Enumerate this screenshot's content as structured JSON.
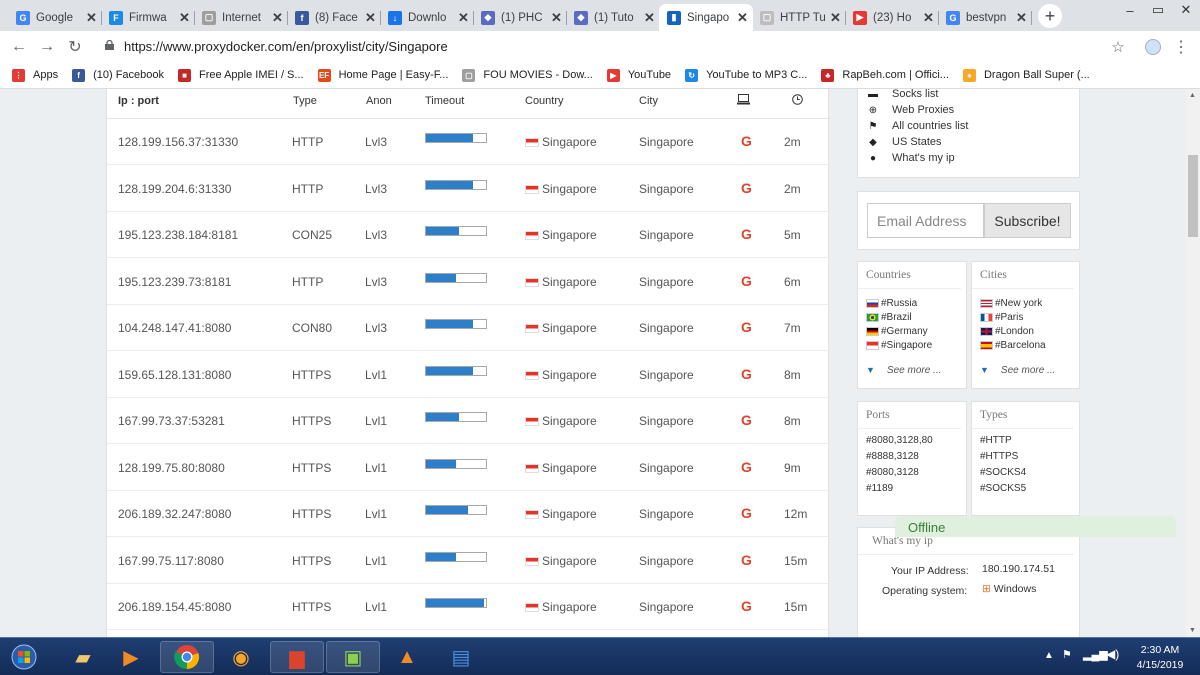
{
  "browser": {
    "tabs": [
      {
        "label": "Google",
        "color": "#4285f4",
        "icon": "G",
        "active": false
      },
      {
        "label": "Firmwa",
        "color": "#1e88e5",
        "icon": "F",
        "active": false
      },
      {
        "label": "Internet",
        "color": "#9e9e9e",
        "icon": "▢",
        "active": false
      },
      {
        "label": "(8) Face",
        "color": "#3b5998",
        "icon": "f",
        "active": false
      },
      {
        "label": "Downlo",
        "color": "#1a73e8",
        "icon": "↓",
        "active": false
      },
      {
        "label": "(1) PHC",
        "color": "#5c6bc0",
        "icon": "◆",
        "active": false
      },
      {
        "label": "(1) Tuto",
        "color": "#5c6bc0",
        "icon": "◆",
        "active": false
      },
      {
        "label": "Singapo",
        "color": "#1565c0",
        "icon": "▮",
        "active": true
      },
      {
        "label": "HTTP Tu",
        "color": "#bdbdbd",
        "icon": "▢",
        "active": false
      },
      {
        "label": "(23) Ho",
        "color": "#e53935",
        "icon": "▶",
        "active": false
      },
      {
        "label": "bestvpn",
        "color": "#4285f4",
        "icon": "G",
        "active": false
      }
    ],
    "url": "https://www.proxydocker.com/en/proxylist/city/Singapore",
    "bookmarks": [
      {
        "label": "Apps",
        "color": "#e53935",
        "icon": "⋮"
      },
      {
        "label": "(10) Facebook",
        "color": "#3b5998",
        "icon": "f"
      },
      {
        "label": "Free Apple IMEI / S...",
        "color": "#c62828",
        "icon": "■"
      },
      {
        "label": "Home Page | Easy-F...",
        "color": "#e64a19",
        "icon": "EF"
      },
      {
        "label": "FOU MOVIES - Dow...",
        "color": "#9e9e9e",
        "icon": "▢"
      },
      {
        "label": "YouTube",
        "color": "#e53935",
        "icon": "▶"
      },
      {
        "label": "YouTube to MP3 C...",
        "color": "#1e88e5",
        "icon": "↻"
      },
      {
        "label": "RapBeh.com | Offici...",
        "color": "#c62828",
        "icon": "♣"
      },
      {
        "label": "Dragon Ball Super (...",
        "color": "#f9a825",
        "icon": "●"
      }
    ]
  },
  "table": {
    "headers": {
      "ip": "Ip : port",
      "type": "Type",
      "anon": "Anon",
      "timeout": "Timeout",
      "country": "Country",
      "city": "City"
    },
    "rows": [
      {
        "ip": "128.199.156.37:31330",
        "type": "HTTP",
        "anon": "Lvl3",
        "timeout": 0.78,
        "country": "Singapore",
        "city": "Singapore",
        "g": "G",
        "age": "2m"
      },
      {
        "ip": "128.199.204.6:31330",
        "type": "HTTP",
        "anon": "Lvl3",
        "timeout": 0.78,
        "country": "Singapore",
        "city": "Singapore",
        "g": "G",
        "age": "2m"
      },
      {
        "ip": "195.123.238.184:8181",
        "type": "CON25",
        "anon": "Lvl3",
        "timeout": 0.55,
        "country": "Singapore",
        "city": "Singapore",
        "g": "G",
        "age": "5m"
      },
      {
        "ip": "195.123.239.73:8181",
        "type": "HTTP",
        "anon": "Lvl3",
        "timeout": 0.5,
        "country": "Singapore",
        "city": "Singapore",
        "g": "G",
        "age": "6m"
      },
      {
        "ip": "104.248.147.41:8080",
        "type": "CON80",
        "anon": "Lvl3",
        "timeout": 0.78,
        "country": "Singapore",
        "city": "Singapore",
        "g": "G",
        "age": "7m"
      },
      {
        "ip": "159.65.128.131:8080",
        "type": "HTTPS",
        "anon": "Lvl1",
        "timeout": 0.78,
        "country": "Singapore",
        "city": "Singapore",
        "g": "G",
        "age": "8m"
      },
      {
        "ip": "167.99.73.37:53281",
        "type": "HTTPS",
        "anon": "Lvl1",
        "timeout": 0.55,
        "country": "Singapore",
        "city": "Singapore",
        "g": "G",
        "age": "8m"
      },
      {
        "ip": "128.199.75.80:8080",
        "type": "HTTPS",
        "anon": "Lvl1",
        "timeout": 0.5,
        "country": "Singapore",
        "city": "Singapore",
        "g": "G",
        "age": "9m"
      },
      {
        "ip": "206.189.32.247:8080",
        "type": "HTTPS",
        "anon": "Lvl1",
        "timeout": 0.7,
        "country": "Singapore",
        "city": "Singapore",
        "g": "G",
        "age": "12m"
      },
      {
        "ip": "167.99.75.117:8080",
        "type": "HTTPS",
        "anon": "Lvl1",
        "timeout": 0.5,
        "country": "Singapore",
        "city": "Singapore",
        "g": "G",
        "age": "15m"
      },
      {
        "ip": "206.189.154.45:8080",
        "type": "HTTPS",
        "anon": "Lvl1",
        "timeout": 0.97,
        "country": "Singapore",
        "city": "Singapore",
        "g": "G",
        "age": "15m"
      }
    ]
  },
  "sidebar": {
    "links": [
      "Socks list",
      "Web Proxies",
      "All countries list",
      "US States",
      "What's my ip"
    ],
    "email_placeholder": "Email Address",
    "subscribe_label": "Subscribe!",
    "countries": {
      "title": "Countries",
      "items": [
        "#Russia",
        "#Brazil",
        "#Germany",
        "#Singapore"
      ],
      "see_more": "See more ..."
    },
    "cities": {
      "title": "Cities",
      "items": [
        "#New york",
        "#Paris",
        "#London",
        "#Barcelona"
      ],
      "see_more": "See more ..."
    },
    "ports": {
      "title": "Ports",
      "items": [
        "#8080,3128,80",
        "#8888,3128",
        "#8080,3128",
        "#1189"
      ]
    },
    "types": {
      "title": "Types",
      "items": [
        "#HTTP",
        "#HTTPS",
        "#SOCKS4",
        "#SOCKS5"
      ]
    },
    "whatsip": {
      "title": "What's my ip",
      "ip_label": "Your IP Address:",
      "ip_value": "180.190.174.51",
      "os_label": "Operating system:",
      "os_value": "Windows"
    }
  },
  "chat": {
    "status": "Offline"
  },
  "taskbar": {
    "time": "2:30 AM",
    "date": "4/15/2019"
  }
}
